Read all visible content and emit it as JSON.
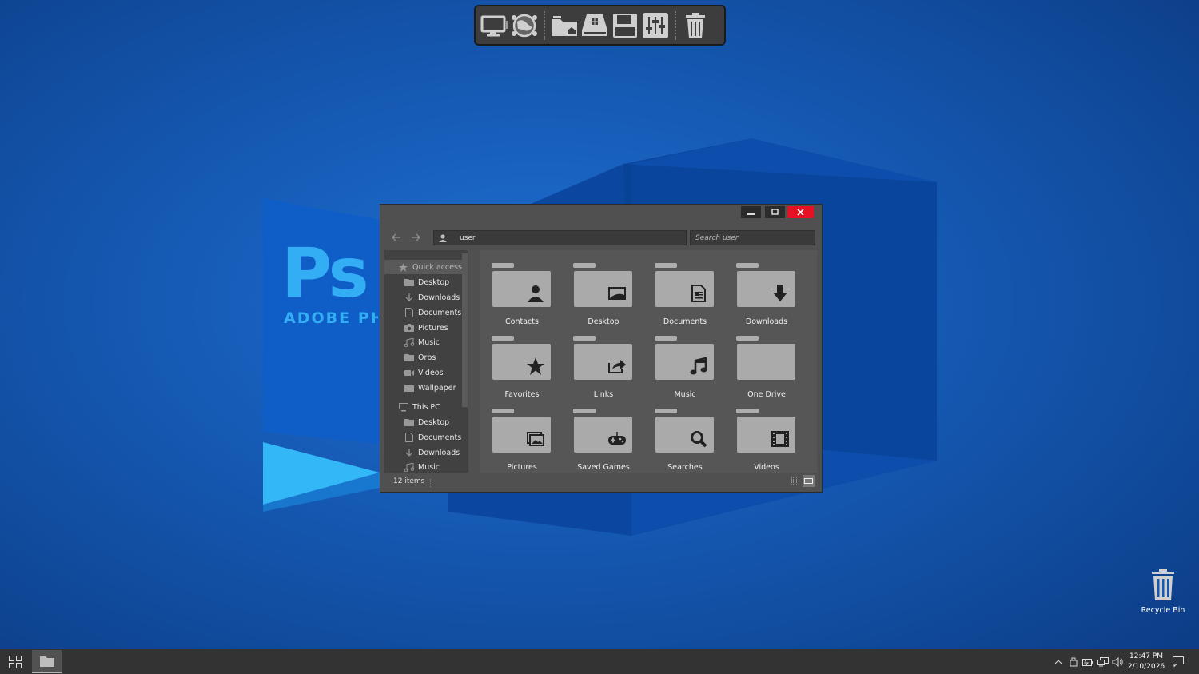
{
  "wallpaper": {
    "logo_text": "Ps",
    "logo_subtitle": "ADOBE PHOTOSHOP"
  },
  "dock": {
    "items": [
      {
        "icon": "monitor-icon"
      },
      {
        "icon": "globe-network-icon"
      },
      {
        "icon": "folder-home-icon"
      },
      {
        "icon": "windows-drive-icon"
      },
      {
        "icon": "floppy-disk-icon"
      },
      {
        "icon": "settings-sliders-icon"
      },
      {
        "icon": "trash-icon"
      }
    ]
  },
  "window": {
    "address": {
      "text": "user",
      "icon": "user-icon"
    },
    "search": {
      "placeholder": "Search user"
    },
    "nav": {
      "quick_access": "Quick access",
      "quick_items": [
        {
          "label": "Desktop",
          "icon": "folder-icon"
        },
        {
          "label": "Downloads",
          "icon": "download-icon"
        },
        {
          "label": "Documents",
          "icon": "document-icon"
        },
        {
          "label": "Pictures",
          "icon": "camera-icon"
        },
        {
          "label": "Music",
          "icon": "music-icon"
        },
        {
          "label": "Orbs",
          "icon": "folder-icon"
        },
        {
          "label": "Videos",
          "icon": "video-icon"
        },
        {
          "label": "Wallpaper",
          "icon": "folder-icon"
        }
      ],
      "this_pc": "This PC",
      "pc_items": [
        {
          "label": "Desktop",
          "icon": "folder-icon"
        },
        {
          "label": "Documents",
          "icon": "document-icon"
        },
        {
          "label": "Downloads",
          "icon": "download-icon"
        },
        {
          "label": "Music",
          "icon": "music-icon"
        }
      ]
    },
    "folders": [
      {
        "label": "Contacts",
        "icon": "person-icon"
      },
      {
        "label": "Desktop",
        "icon": "desktop-image-icon"
      },
      {
        "label": "Documents",
        "icon": "document-icon"
      },
      {
        "label": "Downloads",
        "icon": "download-arrow-icon"
      },
      {
        "label": "Favorites",
        "icon": "star-icon"
      },
      {
        "label": "Links",
        "icon": "share-arrow-icon"
      },
      {
        "label": "Music",
        "icon": "music-note-icon"
      },
      {
        "label": "One Drive",
        "icon": ""
      },
      {
        "label": "Pictures",
        "icon": "pictures-icon"
      },
      {
        "label": "Saved Games",
        "icon": "gamepad-icon"
      },
      {
        "label": "Searches",
        "icon": "magnifier-icon"
      },
      {
        "label": "Videos",
        "icon": "film-icon"
      }
    ],
    "status": {
      "items_count": "12 items"
    }
  },
  "desktop_icons": {
    "recycle_bin": "Recycle Bin"
  },
  "taskbar": {
    "time": "12:47 PM",
    "date": "2/10/2026"
  },
  "colors": {
    "close_button": "#e81123",
    "window_bg": "#505050",
    "ps_blue": "#33aef4"
  }
}
